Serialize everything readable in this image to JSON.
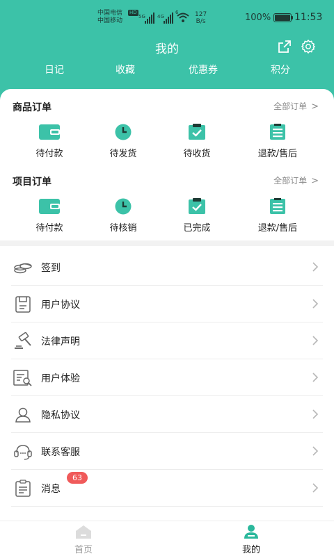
{
  "status_bar": {
    "carrier_1": "中国电信",
    "carrier_1_tag": "HD",
    "carrier_2": "中国移动",
    "net_1": "5G",
    "net_2": "4G",
    "wifi_tag": "6",
    "speed_value": "127",
    "speed_unit": "B/s",
    "battery_percent": "100%",
    "battery_level": 1.0,
    "time": "11:53"
  },
  "header": {
    "title": "我的",
    "share_icon": "share-icon",
    "settings_icon": "gear-icon",
    "background": "#3cc2a8"
  },
  "tabs": [
    {
      "label": "日记"
    },
    {
      "label": "收藏"
    },
    {
      "label": "优惠券"
    },
    {
      "label": "积分"
    }
  ],
  "goods_orders": {
    "title": "商品订单",
    "all_link": "全部订单",
    "items": [
      {
        "label": "待付款",
        "icon": "wallet-icon"
      },
      {
        "label": "待发货",
        "icon": "clock-icon"
      },
      {
        "label": "待收货",
        "icon": "box-check-icon"
      },
      {
        "label": "退款/售后",
        "icon": "clipboard-icon"
      }
    ]
  },
  "project_orders": {
    "title": "项目订单",
    "all_link": "全部订单",
    "items": [
      {
        "label": "待付款",
        "icon": "wallet-icon"
      },
      {
        "label": "待核销",
        "icon": "clock-icon"
      },
      {
        "label": "已完成",
        "icon": "box-check-icon"
      },
      {
        "label": "退款/售后",
        "icon": "clipboard-icon"
      }
    ]
  },
  "menu": {
    "items": [
      {
        "label": "签到",
        "icon": "coins-icon"
      },
      {
        "label": "用户协议",
        "icon": "agreement-icon"
      },
      {
        "label": "法律声明",
        "icon": "gavel-icon"
      },
      {
        "label": "用户体验",
        "icon": "document-search-icon"
      },
      {
        "label": "隐私协议",
        "icon": "person-icon"
      },
      {
        "label": "联系客服",
        "icon": "headset-icon"
      },
      {
        "label": "消息",
        "icon": "message-clipboard-icon",
        "badge": "63"
      }
    ]
  },
  "bottom_nav": {
    "items": [
      {
        "label": "首页",
        "icon": "home-icon",
        "active": false
      },
      {
        "label": "我的",
        "icon": "profile-icon",
        "active": true
      }
    ],
    "active_color": "#2bb89c",
    "inactive_color": "#999999"
  },
  "colors": {
    "accent": "#3cc2a8",
    "badge": "#f05a5a"
  }
}
